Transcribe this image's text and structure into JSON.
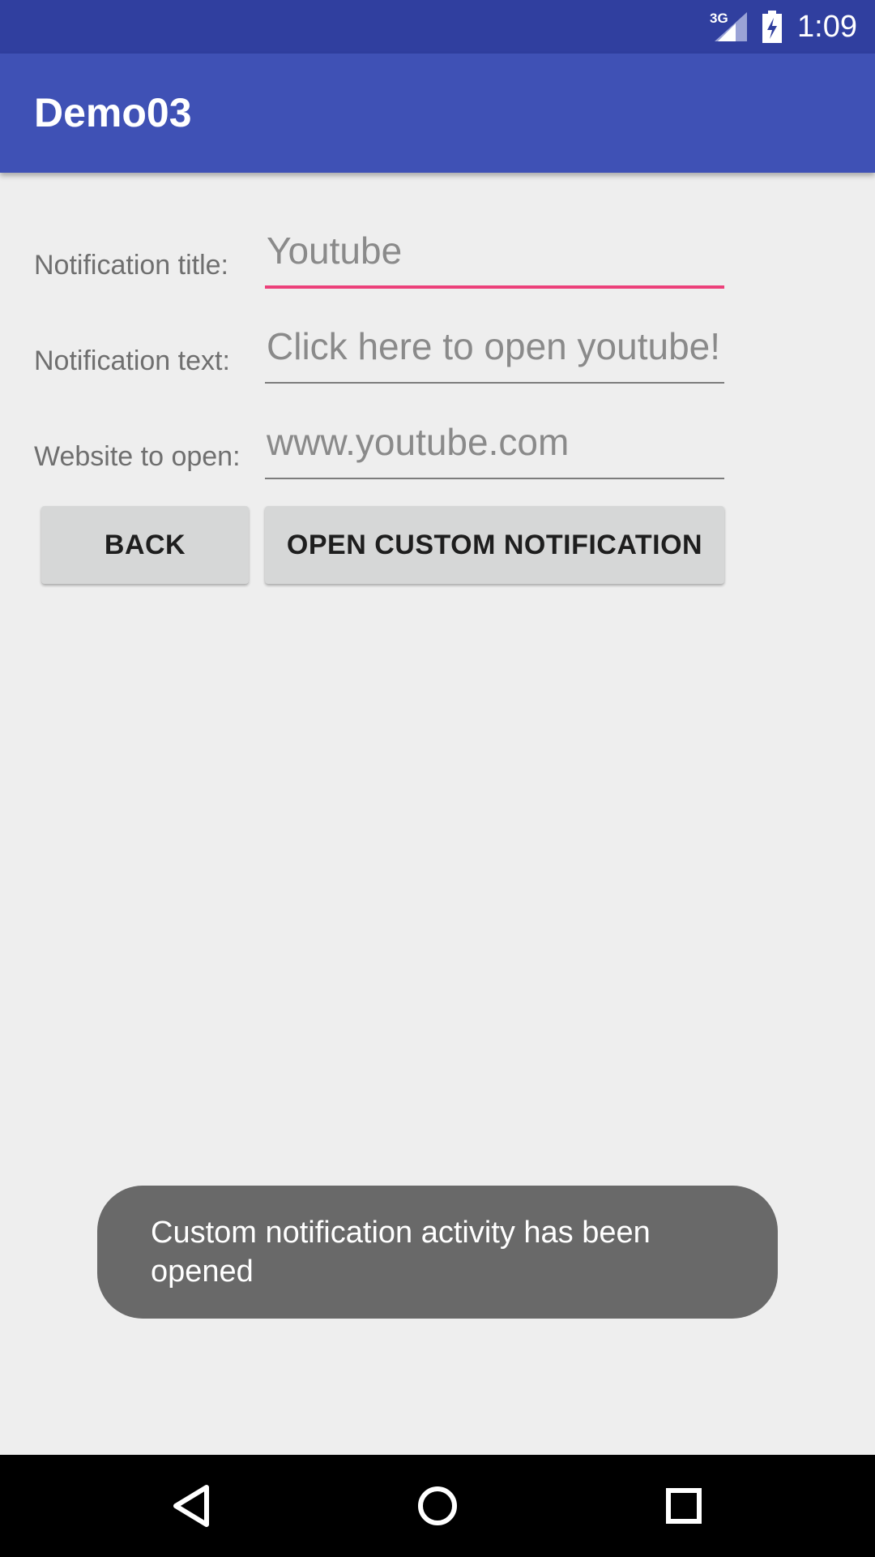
{
  "status_bar": {
    "network_type": "3G",
    "time": "1:09",
    "icons": [
      "signal-icon",
      "battery-charging-icon"
    ]
  },
  "app_bar": {
    "title": "Demo03"
  },
  "form": {
    "fields": [
      {
        "label": "Notification title:",
        "placeholder": "Youtube",
        "value": "",
        "focused": true
      },
      {
        "label": "Notification text:",
        "placeholder": "Click here to open youtube!",
        "value": "",
        "focused": false
      },
      {
        "label": "Website to open:",
        "placeholder": "www.youtube.com",
        "value": "",
        "focused": false
      }
    ]
  },
  "buttons": {
    "back_label": "BACK",
    "open_label": "OPEN CUSTOM NOTIFICATION"
  },
  "toast": {
    "message": "Custom notification activity has been opened"
  },
  "nav_bar": {
    "icons": [
      "back-triangle-icon",
      "home-circle-icon",
      "recents-square-icon"
    ]
  },
  "colors": {
    "status_bar": "#303f9f",
    "app_bar": "#3f51b5",
    "accent": "#ec407a",
    "background": "#eeeeee",
    "toast": "#696969"
  }
}
